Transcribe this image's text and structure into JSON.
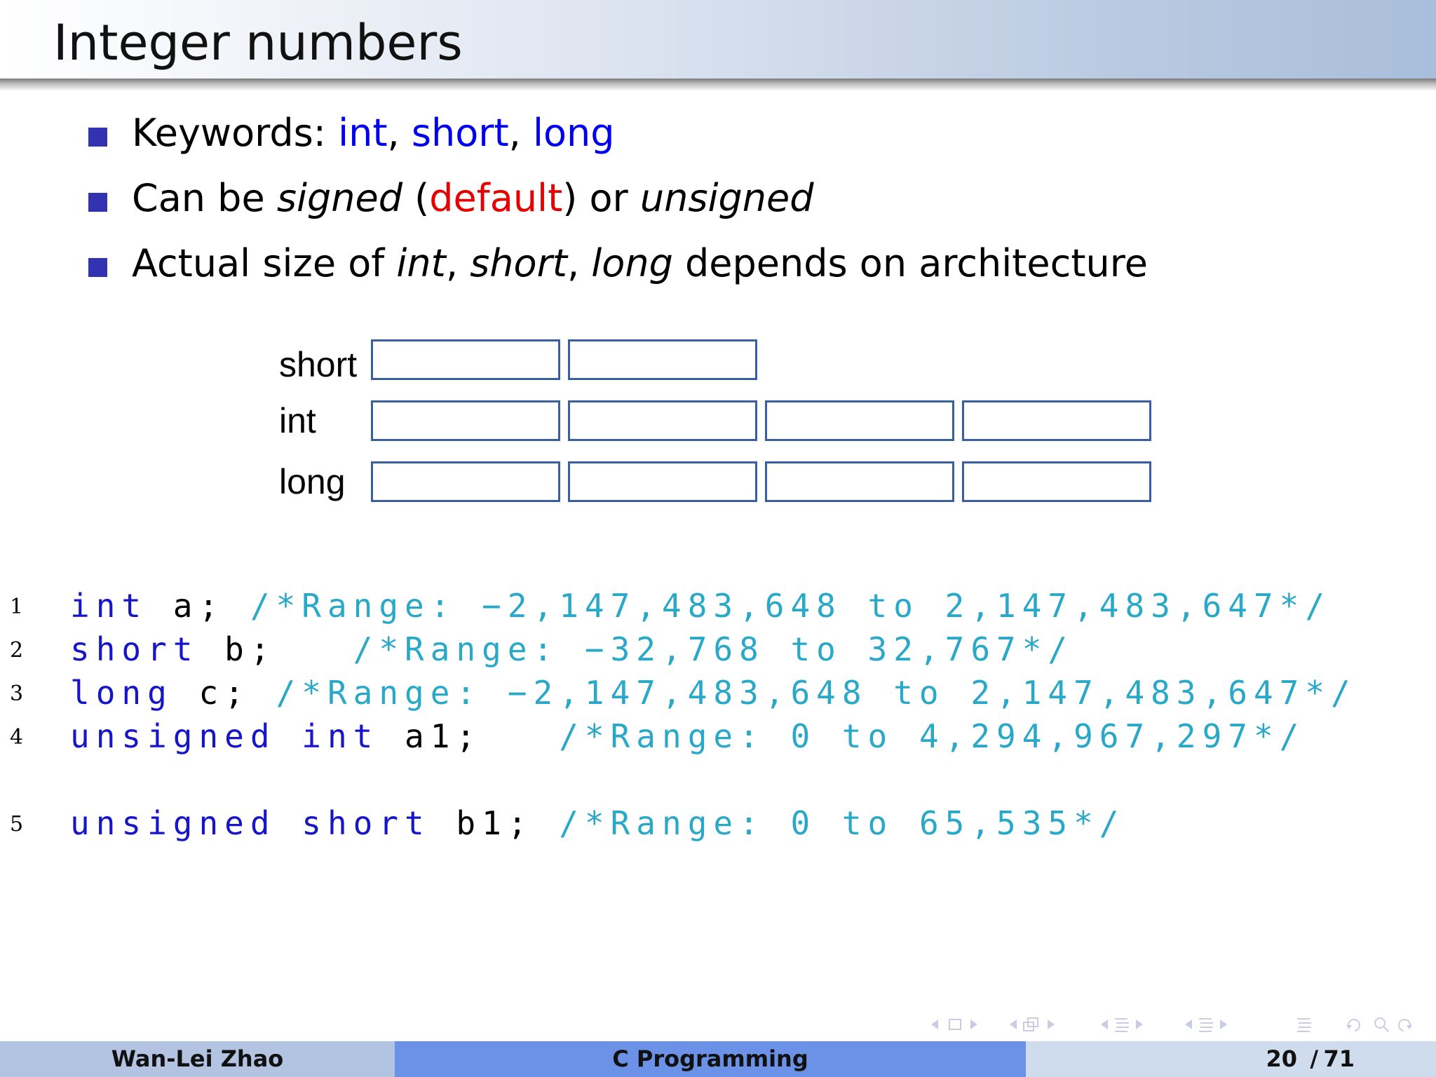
{
  "slide": {
    "title": "Integer numbers",
    "bullets": [
      {
        "parts": [
          "Keywords: ",
          "int",
          ", ",
          "short",
          ", ",
          "long"
        ]
      },
      {
        "parts": [
          "Can be ",
          "signed",
          " (",
          "default",
          ") or ",
          "unsigned"
        ]
      },
      {
        "parts": [
          "Actual size of ",
          "int",
          ", ",
          "short",
          ", ",
          "long",
          " depends on architecture"
        ]
      }
    ]
  },
  "diagram": {
    "rows": [
      {
        "label": "short",
        "cells": 2
      },
      {
        "label": "int",
        "cells": 4
      },
      {
        "label": "long",
        "cells": 4
      }
    ]
  },
  "code": {
    "lines": [
      {
        "num": "1",
        "kw": "int",
        "decl": " a;",
        "comment": "/*Range: −2,147,483,648 to 2,147,483,647*/"
      },
      {
        "num": "2",
        "kw": "short",
        "decl": " b;",
        "comment": "/*Range: −32,768 to 32,767*/"
      },
      {
        "num": "3",
        "kw": "long",
        "decl": " c;",
        "comment": "/*Range: −2,147,483,648 to 2,147,483,647*/"
      },
      {
        "num": "4",
        "kw": "unsigned int",
        "decl": " a1;",
        "comment": "/*Range: 0 to 4,294,967,297*/"
      },
      {
        "num": "5",
        "kw": "unsigned short",
        "decl": " b1;",
        "comment": "/*Range: 0 to 65,535*/"
      }
    ]
  },
  "footer": {
    "author": "Wan-Lei Zhao",
    "course": "C Programming",
    "page_current": "20",
    "page_sep": "/",
    "page_total": "71"
  },
  "colors": {
    "keyword_blue": "#0000ee",
    "emphasis_red": "#e60000",
    "bullet_square": "#3333b2",
    "code_keyword": "#1616c8",
    "code_comment": "#2aa8c8",
    "box_border": "#3a5f9e"
  },
  "nav_icons": [
    "arrow-left-icon",
    "frame-icon",
    "arrow-right-icon",
    "subsection-icon",
    "section-icon",
    "align-icon",
    "search-icon"
  ]
}
